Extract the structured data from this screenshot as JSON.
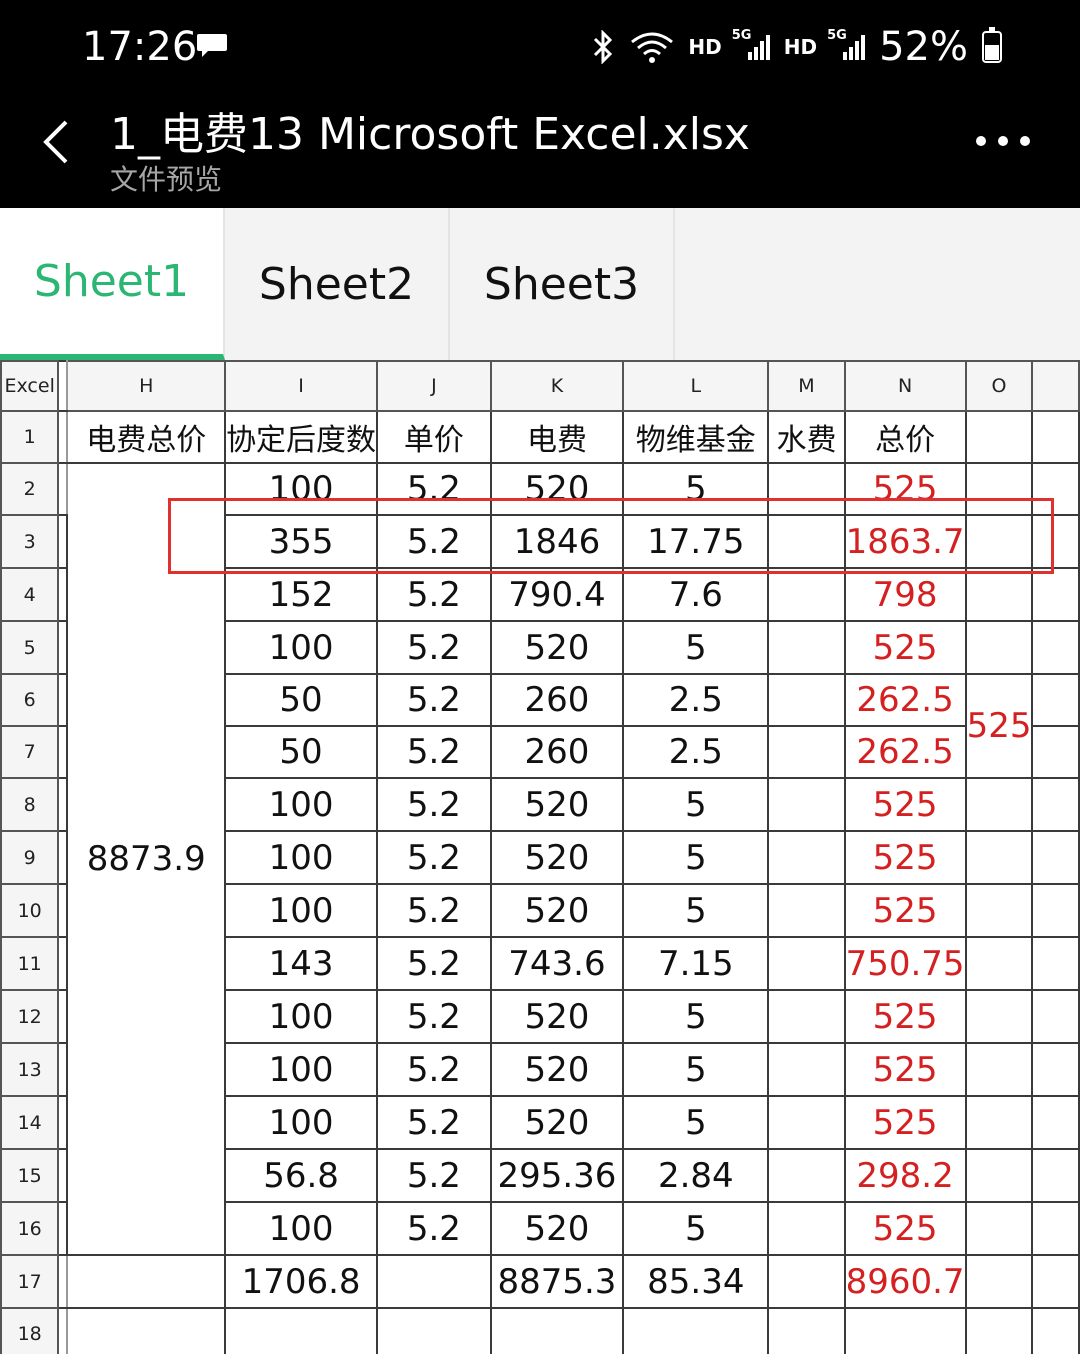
{
  "status_bar": {
    "time": "17:26",
    "battery": "52%",
    "hd1": "HD",
    "hd2": "HD",
    "net1": "5G",
    "net2": "5G",
    "icons": [
      "message-icon",
      "bluetooth-icon",
      "wifi-icon",
      "signal-icon",
      "battery-icon"
    ]
  },
  "header": {
    "title": "1_电费13 Microsoft Excel.xlsx",
    "subtitle": "文件预览"
  },
  "tabs": [
    {
      "label": "Sheet1",
      "active": true
    },
    {
      "label": "Sheet2",
      "active": false
    },
    {
      "label": "Sheet3",
      "active": false
    }
  ],
  "sheet": {
    "corner": "Excel",
    "columns": [
      "H",
      "I",
      "J",
      "K",
      "L",
      "M",
      "N",
      "O"
    ],
    "row_numbers": [
      "1",
      "2",
      "3",
      "4",
      "5",
      "6",
      "7",
      "8",
      "9",
      "10",
      "11",
      "12",
      "13",
      "14",
      "15",
      "16",
      "17",
      "18"
    ],
    "header_row": [
      "电费总价",
      "协定后度数",
      "单价",
      "电费",
      "物维基金",
      "水费",
      "总价",
      ""
    ],
    "merged_h_value": "8873.9",
    "merged_o_value": "525",
    "rows": [
      {
        "I": "100",
        "J": "5.2",
        "K": "520",
        "L": "5",
        "M": "",
        "N": "525"
      },
      {
        "I": "355",
        "J": "5.2",
        "K": "1846",
        "L": "17.75",
        "M": "",
        "N": "1863.7"
      },
      {
        "I": "152",
        "J": "5.2",
        "K": "790.4",
        "L": "7.6",
        "M": "",
        "N": "798"
      },
      {
        "I": "100",
        "J": "5.2",
        "K": "520",
        "L": "5",
        "M": "",
        "N": "525"
      },
      {
        "I": "50",
        "J": "5.2",
        "K": "260",
        "L": "2.5",
        "M": "",
        "N": "262.5"
      },
      {
        "I": "50",
        "J": "5.2",
        "K": "260",
        "L": "2.5",
        "M": "",
        "N": "262.5"
      },
      {
        "I": "100",
        "J": "5.2",
        "K": "520",
        "L": "5",
        "M": "",
        "N": "525"
      },
      {
        "I": "100",
        "J": "5.2",
        "K": "520",
        "L": "5",
        "M": "",
        "N": "525"
      },
      {
        "I": "100",
        "J": "5.2",
        "K": "520",
        "L": "5",
        "M": "",
        "N": "525"
      },
      {
        "I": "143",
        "J": "5.2",
        "K": "743.6",
        "L": "7.15",
        "M": "",
        "N": "750.75"
      },
      {
        "I": "100",
        "J": "5.2",
        "K": "520",
        "L": "5",
        "M": "",
        "N": "525"
      },
      {
        "I": "100",
        "J": "5.2",
        "K": "520",
        "L": "5",
        "M": "",
        "N": "525"
      },
      {
        "I": "100",
        "J": "5.2",
        "K": "520",
        "L": "5",
        "M": "",
        "N": "525"
      },
      {
        "I": "56.8",
        "J": "5.2",
        "K": "295.36",
        "L": "2.84",
        "M": "",
        "N": "298.2"
      },
      {
        "I": "100",
        "J": "5.2",
        "K": "520",
        "L": "5",
        "M": "",
        "N": "525"
      }
    ],
    "totals_row": {
      "H": "",
      "I": "1706.8",
      "J": "",
      "K": "8875.3",
      "L": "85.34",
      "M": "",
      "N": "8960.7",
      "O": ""
    },
    "highlighted_row": "3",
    "colors": {
      "total_price_text": "#d42020",
      "active_tab": "#2bb673",
      "highlight_box": "#e03030"
    }
  }
}
